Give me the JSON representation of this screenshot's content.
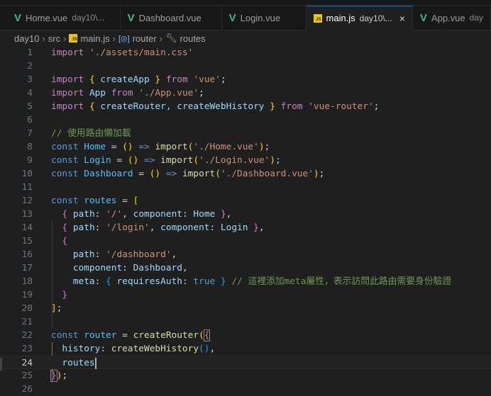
{
  "tabs": [
    {
      "label": "Home.vue",
      "desc": "day10\\...",
      "icon": "vue-icon",
      "active": false
    },
    {
      "label": "Dashboard.vue",
      "desc": "",
      "icon": "vue-icon",
      "active": false
    },
    {
      "label": "Login.vue",
      "desc": "",
      "icon": "vue-icon",
      "active": false
    },
    {
      "label": "main.js",
      "desc": "day10\\...",
      "icon": "js-icon",
      "active": true,
      "close": "×"
    },
    {
      "label": "App.vue",
      "desc": "day",
      "icon": "vue-icon",
      "active": false
    }
  ],
  "breadcrumb": {
    "items": [
      "day10",
      "src",
      "main.js",
      "router",
      "routes"
    ],
    "sep": "›",
    "js_badge": "JS"
  },
  "editor": {
    "current_line": 24,
    "lines": [
      [
        [
          "import",
          "ctl"
        ],
        [
          " ",
          "pl"
        ],
        [
          "'./assets/main.css'",
          "str"
        ]
      ],
      [],
      [
        [
          "import",
          "ctl"
        ],
        [
          " ",
          "pl"
        ],
        [
          "{",
          "b1"
        ],
        [
          " createApp ",
          "var"
        ],
        [
          "}",
          "b1"
        ],
        [
          " ",
          "pl"
        ],
        [
          "from",
          "ctl"
        ],
        [
          " ",
          "pl"
        ],
        [
          "'vue'",
          "str"
        ],
        [
          ";",
          "pl"
        ]
      ],
      [
        [
          "import",
          "ctl"
        ],
        [
          " App ",
          "var"
        ],
        [
          "from",
          "ctl"
        ],
        [
          " ",
          "pl"
        ],
        [
          "'./App.vue'",
          "str"
        ],
        [
          ";",
          "pl"
        ]
      ],
      [
        [
          "import",
          "ctl"
        ],
        [
          " ",
          "pl"
        ],
        [
          "{",
          "b1"
        ],
        [
          " createRouter, createWebHistory ",
          "var"
        ],
        [
          "}",
          "b1"
        ],
        [
          " ",
          "pl"
        ],
        [
          "from",
          "ctl"
        ],
        [
          " ",
          "pl"
        ],
        [
          "'vue-router'",
          "str"
        ],
        [
          ";",
          "pl"
        ]
      ],
      [],
      [
        [
          "// 使用路由懶加載",
          "cm"
        ]
      ],
      [
        [
          "const",
          "kw"
        ],
        [
          " Home ",
          "cst"
        ],
        [
          "= ",
          "pl"
        ],
        [
          "()",
          "b1"
        ],
        [
          " => ",
          "kw"
        ],
        [
          "import",
          "fn"
        ],
        [
          "(",
          "b1"
        ],
        [
          "'./Home.vue'",
          "str"
        ],
        [
          ")",
          "b1"
        ],
        [
          ";",
          "pl"
        ]
      ],
      [
        [
          "const",
          "kw"
        ],
        [
          " Login ",
          "cst"
        ],
        [
          "= ",
          "pl"
        ],
        [
          "()",
          "b1"
        ],
        [
          " => ",
          "kw"
        ],
        [
          "import",
          "fn"
        ],
        [
          "(",
          "b1"
        ],
        [
          "'./Login.vue'",
          "str"
        ],
        [
          ")",
          "b1"
        ],
        [
          ";",
          "pl"
        ]
      ],
      [
        [
          "const",
          "kw"
        ],
        [
          " Dashboard ",
          "cst"
        ],
        [
          "= ",
          "pl"
        ],
        [
          "()",
          "b1"
        ],
        [
          " => ",
          "kw"
        ],
        [
          "import",
          "fn"
        ],
        [
          "(",
          "b1"
        ],
        [
          "'./Dashboard.vue'",
          "str"
        ],
        [
          ")",
          "b1"
        ],
        [
          ";",
          "pl"
        ]
      ],
      [],
      [
        [
          "const",
          "kw"
        ],
        [
          " routes ",
          "cst"
        ],
        [
          "= ",
          "pl"
        ],
        [
          "[",
          "b1"
        ]
      ],
      [
        [
          "  ",
          "pl"
        ],
        [
          "{",
          "b2"
        ],
        [
          " path",
          "var"
        ],
        [
          ": ",
          "pl"
        ],
        [
          "'/'",
          "str"
        ],
        [
          ", ",
          "pl"
        ],
        [
          "component",
          "var"
        ],
        [
          ": ",
          "pl"
        ],
        [
          "Home",
          "var"
        ],
        [
          " ",
          "pl"
        ],
        [
          "}",
          "b2"
        ],
        [
          ",",
          "pl"
        ]
      ],
      [
        [
          "  ",
          "pl"
        ],
        [
          "{",
          "b2"
        ],
        [
          " path",
          "var"
        ],
        [
          ": ",
          "pl"
        ],
        [
          "'/login'",
          "str"
        ],
        [
          ", ",
          "pl"
        ],
        [
          "component",
          "var"
        ],
        [
          ": ",
          "pl"
        ],
        [
          "Login",
          "var"
        ],
        [
          " ",
          "pl"
        ],
        [
          "}",
          "b2"
        ],
        [
          ",",
          "pl"
        ]
      ],
      [
        [
          "  ",
          "pl"
        ],
        [
          "{",
          "b2"
        ]
      ],
      [
        [
          "    path",
          "var"
        ],
        [
          ": ",
          "pl"
        ],
        [
          "'/dashboard'",
          "str"
        ],
        [
          ",",
          "pl"
        ]
      ],
      [
        [
          "    component",
          "var"
        ],
        [
          ": ",
          "pl"
        ],
        [
          "Dashboard",
          "var"
        ],
        [
          ",",
          "pl"
        ]
      ],
      [
        [
          "    meta",
          "var"
        ],
        [
          ": ",
          "pl"
        ],
        [
          "{",
          "b3"
        ],
        [
          " requiresAuth",
          "var"
        ],
        [
          ": ",
          "pl"
        ],
        [
          "true",
          "bool"
        ],
        [
          " ",
          "pl"
        ],
        [
          "}",
          "b3"
        ],
        [
          " // 這裡添加meta屬性，表示訪問此路由需要身份驗證",
          "cm"
        ]
      ],
      [
        [
          "  ",
          "pl"
        ],
        [
          "}",
          "b2"
        ]
      ],
      [
        [
          "]",
          "b1"
        ],
        [
          ";",
          "pl"
        ]
      ],
      [],
      [
        [
          "const",
          "kw"
        ],
        [
          " router ",
          "cst"
        ],
        [
          "= ",
          "pl"
        ],
        [
          "createRouter",
          "fn"
        ],
        [
          "(",
          "b1"
        ],
        [
          "{",
          "b2 hb"
        ]
      ],
      [
        [
          "  history",
          "var"
        ],
        [
          ": ",
          "pl"
        ],
        [
          "createWebHistory",
          "fn"
        ],
        [
          "()",
          "b3"
        ],
        [
          ",",
          "pl"
        ]
      ],
      [
        [
          "  routes",
          "var"
        ]
      ],
      [
        [
          "}",
          "b2 hb"
        ],
        [
          ")",
          "b1"
        ],
        [
          ";",
          "pl"
        ]
      ],
      []
    ]
  }
}
